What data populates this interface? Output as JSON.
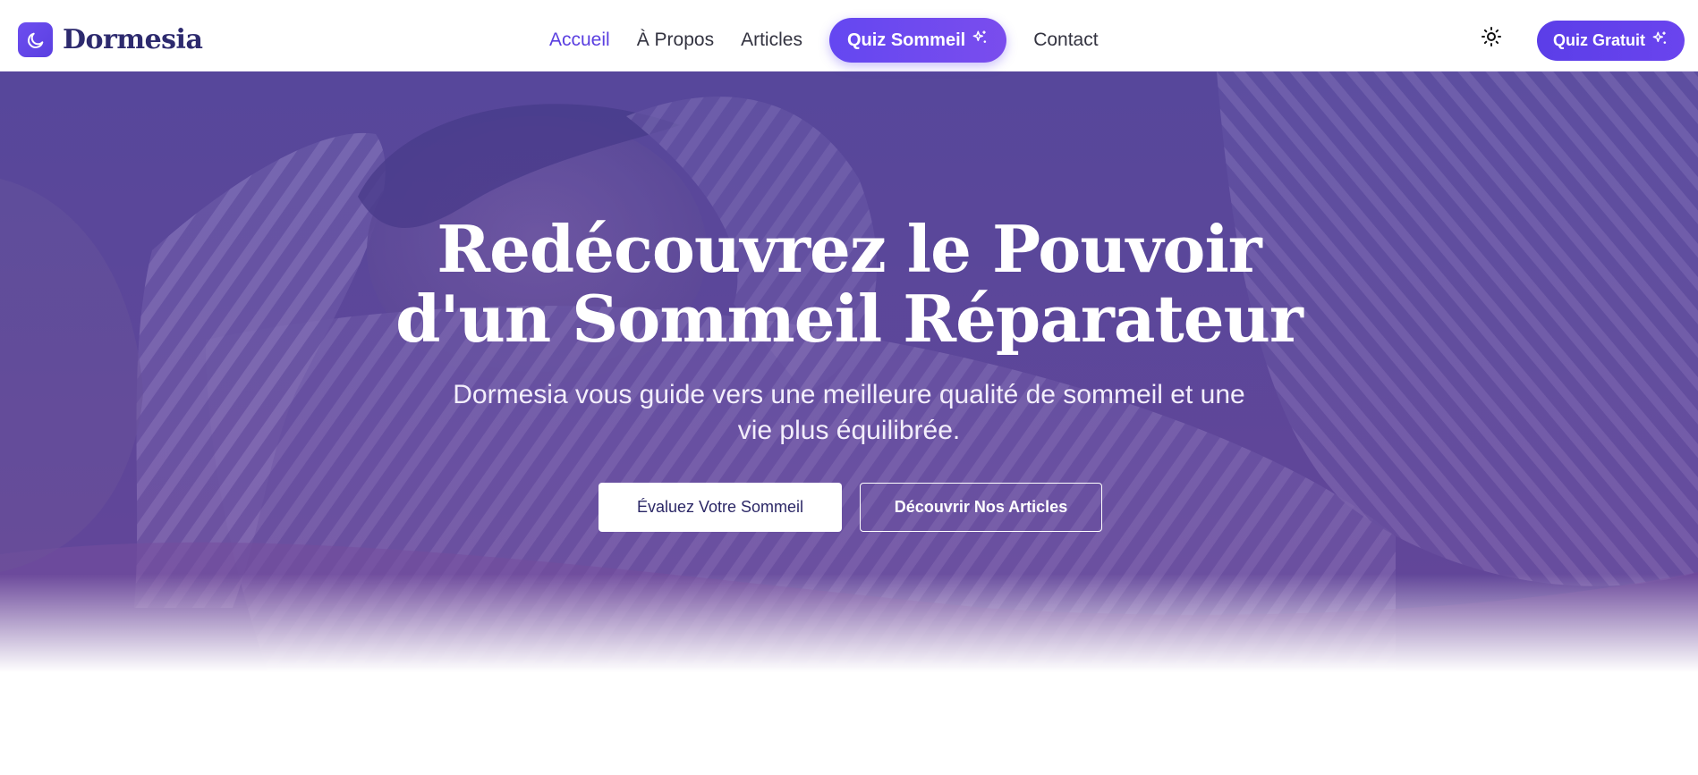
{
  "brand": {
    "name": "Dormesia",
    "icon": "moon-icon"
  },
  "nav": {
    "items": [
      {
        "label": "Accueil",
        "active": true
      },
      {
        "label": "À Propos",
        "active": false
      },
      {
        "label": "Articles",
        "active": false
      }
    ],
    "quiz": {
      "label": "Quiz Sommeil",
      "icon": "sparkles-icon"
    },
    "contact": {
      "label": "Contact"
    }
  },
  "header_actions": {
    "theme_toggle_icon": "sun-icon",
    "quiz_button": {
      "label": "Quiz Gratuit",
      "icon": "sparkles-icon"
    }
  },
  "hero": {
    "title_line1": "Redécouvrez le Pouvoir",
    "title_line2": "d'un Sommeil Réparateur",
    "subtitle_line1": "Dormesia vous guide vers une meilleure qualité de sommeil et une",
    "subtitle_line2": "vie plus équilibrée.",
    "cta_primary": "Évaluez Votre Sommeil",
    "cta_secondary": "Découvrir Nos Articles",
    "background": "sleeping-person-image"
  },
  "colors": {
    "accent": "#5a3fe0",
    "brand_text": "#2d2a6e",
    "hero_overlay": "#62489a"
  }
}
